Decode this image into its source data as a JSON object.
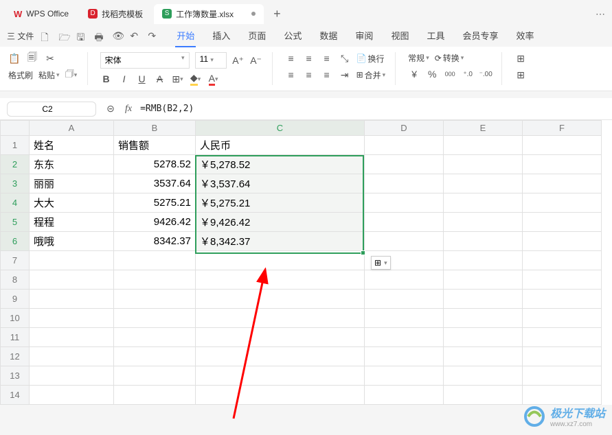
{
  "titleTabs": {
    "wps": "WPS Office",
    "template": "找稻壳模板",
    "doc": "工作簿数量.xlsx",
    "add": "+"
  },
  "menubar": {
    "fileMenu": "三 文件",
    "items": [
      "开始",
      "插入",
      "页面",
      "公式",
      "数据",
      "审阅",
      "视图",
      "工具",
      "会员专享",
      "效率"
    ],
    "activeIndex": 0
  },
  "toolbar": {
    "formatPainter": "格式刷",
    "paste": "粘贴",
    "fontName": "宋体",
    "fontSize": "11",
    "bold": "B",
    "italic": "I",
    "underline": "U",
    "strike": "A",
    "wrap": "换行",
    "merge": "合并",
    "numFmt": "常规",
    "rotate": "转换",
    "yen": "¥",
    "percent": "%",
    "comma": "000",
    "dec1": "⁺.0",
    "dec0": "⁻.00",
    "shrink": "A⁻",
    "grow": "A⁺"
  },
  "formulaBar": {
    "nameBox": "C2",
    "fx": "fx",
    "formula": "=RMB(B2,2)"
  },
  "sheet": {
    "cols": [
      "A",
      "B",
      "C",
      "D",
      "E",
      "F"
    ],
    "rows": [
      {
        "n": "1",
        "A": "姓名",
        "B": "销售额",
        "C": "人民币"
      },
      {
        "n": "2",
        "A": "东东",
        "B": "5278.52",
        "C": "￥5,278.52"
      },
      {
        "n": "3",
        "A": "丽丽",
        "B": "3537.64",
        "C": "￥3,537.64"
      },
      {
        "n": "4",
        "A": "大大",
        "B": "5275.21",
        "C": "￥5,275.21"
      },
      {
        "n": "5",
        "A": "程程",
        "B": "9426.42",
        "C": "￥9,426.42"
      },
      {
        "n": "6",
        "A": "哦哦",
        "B": "8342.37",
        "C": "￥8,342.37"
      },
      {
        "n": "7"
      },
      {
        "n": "8"
      },
      {
        "n": "9"
      },
      {
        "n": "10"
      },
      {
        "n": "11"
      },
      {
        "n": "12"
      },
      {
        "n": "13"
      },
      {
        "n": "14"
      }
    ]
  },
  "watermark": {
    "text": "极光下载站",
    "url": "www.xz7.com"
  }
}
